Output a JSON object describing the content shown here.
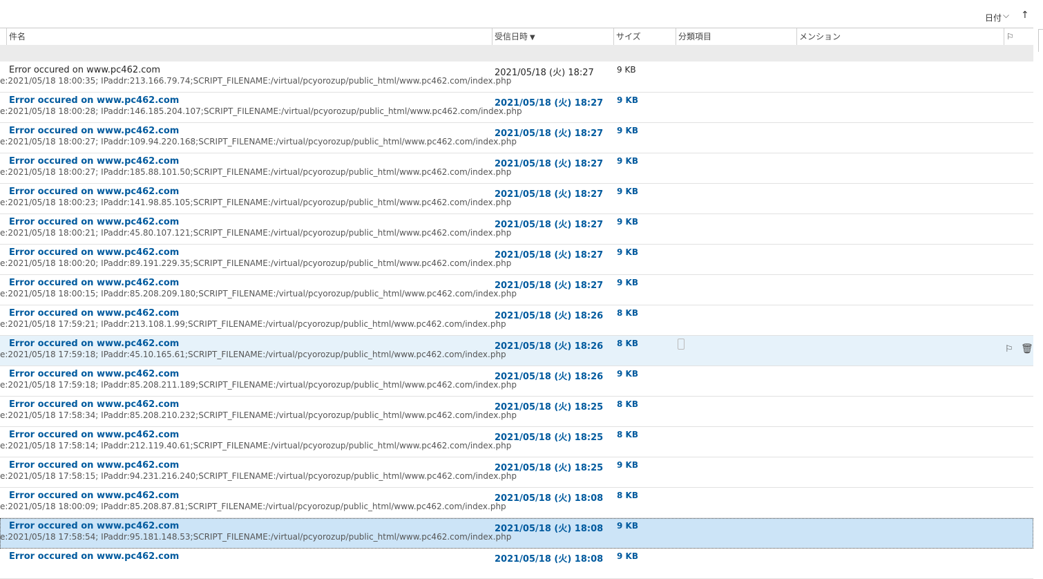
{
  "sortbar": {
    "label": "日付",
    "chevron": "⌵",
    "direction_icon": "↑"
  },
  "columns": {
    "subject": "件名",
    "received": "受信日時",
    "received_arrow": "▼",
    "size": "サイズ",
    "category": "分類項目",
    "mention": "メンション",
    "flag_header_icon": "⚐"
  },
  "messages": [
    {
      "subject": "Error occured on www.pc462.com",
      "preview": "e:2021/05/18 18:00:35; IPaddr:213.166.79.74;SCRIPT_FILENAME:/virtual/pcyorozup/public_html/www.pc462.com/index.php",
      "date": "2021/05/18 (火) 18:27",
      "size": "9 KB"
    },
    {
      "subject": "Error occured on www.pc462.com",
      "preview": "e:2021/05/18 18:00:28; IPaddr:146.185.204.107;SCRIPT_FILENAME:/virtual/pcyorozup/public_html/www.pc462.com/index.php",
      "date": "2021/05/18 (火) 18:27",
      "size": "9 KB"
    },
    {
      "subject": "Error occured on www.pc462.com",
      "preview": "e:2021/05/18 18:00:27; IPaddr:109.94.220.168;SCRIPT_FILENAME:/virtual/pcyorozup/public_html/www.pc462.com/index.php",
      "date": "2021/05/18 (火) 18:27",
      "size": "9 KB"
    },
    {
      "subject": "Error occured on www.pc462.com",
      "preview": "e:2021/05/18 18:00:27; IPaddr:185.88.101.50;SCRIPT_FILENAME:/virtual/pcyorozup/public_html/www.pc462.com/index.php",
      "date": "2021/05/18 (火) 18:27",
      "size": "9 KB"
    },
    {
      "subject": "Error occured on www.pc462.com",
      "preview": "e:2021/05/18 18:00:23; IPaddr:141.98.85.105;SCRIPT_FILENAME:/virtual/pcyorozup/public_html/www.pc462.com/index.php",
      "date": "2021/05/18 (火) 18:27",
      "size": "9 KB"
    },
    {
      "subject": "Error occured on www.pc462.com",
      "preview": "e:2021/05/18 18:00:21; IPaddr:45.80.107.121;SCRIPT_FILENAME:/virtual/pcyorozup/public_html/www.pc462.com/index.php",
      "date": "2021/05/18 (火) 18:27",
      "size": "9 KB"
    },
    {
      "subject": "Error occured on www.pc462.com",
      "preview": "e:2021/05/18 18:00:20; IPaddr:89.191.229.35;SCRIPT_FILENAME:/virtual/pcyorozup/public_html/www.pc462.com/index.php",
      "date": "2021/05/18 (火) 18:27",
      "size": "9 KB"
    },
    {
      "subject": "Error occured on www.pc462.com",
      "preview": "e:2021/05/18 18:00:15; IPaddr:85.208.209.180;SCRIPT_FILENAME:/virtual/pcyorozup/public_html/www.pc462.com/index.php",
      "date": "2021/05/18 (火) 18:27",
      "size": "9 KB"
    },
    {
      "subject": "Error occured on www.pc462.com",
      "preview": "e:2021/05/18 17:59:21; IPaddr:213.108.1.99;SCRIPT_FILENAME:/virtual/pcyorozup/public_html/www.pc462.com/index.php",
      "date": "2021/05/18 (火) 18:26",
      "size": "8 KB"
    },
    {
      "subject": "Error occured on www.pc462.com",
      "preview": "e:2021/05/18 17:59:18; IPaddr:45.10.165.61;SCRIPT_FILENAME:/virtual/pcyorozup/public_html/www.pc462.com/index.php",
      "date": "2021/05/18 (火) 18:26",
      "size": "8 KB"
    },
    {
      "subject": "Error occured on www.pc462.com",
      "preview": "e:2021/05/18 17:59:18; IPaddr:85.208.211.189;SCRIPT_FILENAME:/virtual/pcyorozup/public_html/www.pc462.com/index.php",
      "date": "2021/05/18 (火) 18:26",
      "size": "9 KB"
    },
    {
      "subject": "Error occured on www.pc462.com",
      "preview": "e:2021/05/18 17:58:34; IPaddr:85.208.210.232;SCRIPT_FILENAME:/virtual/pcyorozup/public_html/www.pc462.com/index.php",
      "date": "2021/05/18 (火) 18:25",
      "size": "8 KB"
    },
    {
      "subject": "Error occured on www.pc462.com",
      "preview": "e:2021/05/18 17:58:14; IPaddr:212.119.40.61;SCRIPT_FILENAME:/virtual/pcyorozup/public_html/www.pc462.com/index.php",
      "date": "2021/05/18 (火) 18:25",
      "size": "8 KB"
    },
    {
      "subject": "Error occured on www.pc462.com",
      "preview": "e:2021/05/18 17:58:15; IPaddr:94.231.216.240;SCRIPT_FILENAME:/virtual/pcyorozup/public_html/www.pc462.com/index.php",
      "date": "2021/05/18 (火) 18:25",
      "size": "9 KB"
    },
    {
      "subject": "Error occured on www.pc462.com",
      "preview": "e:2021/05/18 18:00:09; IPaddr:85.208.87.81;SCRIPT_FILENAME:/virtual/pcyorozup/public_html/www.pc462.com/index.php",
      "date": "2021/05/18 (火) 18:08",
      "size": "8 KB"
    },
    {
      "subject": "Error occured on www.pc462.com",
      "preview": "e:2021/05/18 17:58:54; IPaddr:95.181.148.53;SCRIPT_FILENAME:/virtual/pcyorozup/public_html/www.pc462.com/index.php",
      "date": "2021/05/18 (火) 18:08",
      "size": "9 KB"
    },
    {
      "subject": "Error occured on www.pc462.com",
      "preview": "",
      "date": "2021/05/18 (火) 18:08",
      "size": "9 KB"
    }
  ],
  "row_actions": {
    "flag_icon": "⚐",
    "trash_icon": "🗑"
  }
}
